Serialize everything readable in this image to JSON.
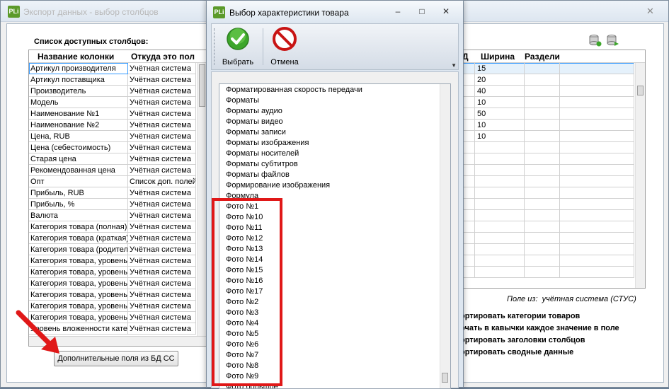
{
  "background_window": {
    "title": "Экспорт данных - выбор столбцов",
    "icon_text": "PLi",
    "close_glyph": "✕",
    "list_caption": "Список доступных столбцов:",
    "columns": [
      "Название колонки",
      "Откуда это пол"
    ],
    "rows": [
      {
        "name": "Артикул производителя",
        "source": "Учётная система"
      },
      {
        "name": "Артикул поставщика",
        "source": "Учётная система"
      },
      {
        "name": "Производитель",
        "source": "Учётная система"
      },
      {
        "name": "Модель",
        "source": "Учётная система"
      },
      {
        "name": "Наименование №1",
        "source": "Учётная система"
      },
      {
        "name": "Наименование №2",
        "source": "Учётная система"
      },
      {
        "name": "Цена, RUB",
        "source": "Учётная система"
      },
      {
        "name": "Цена (себестоимость)",
        "source": "Учётная система"
      },
      {
        "name": "Старая цена",
        "source": "Учётная система"
      },
      {
        "name": "Рекомендованная цена",
        "source": "Учётная система"
      },
      {
        "name": "Опт",
        "source": "Список доп. полей"
      },
      {
        "name": "Прибыль, RUB",
        "source": "Учётная система"
      },
      {
        "name": "Прибыль, %",
        "source": "Учётная система"
      },
      {
        "name": "Валюта",
        "source": "Учётная система"
      },
      {
        "name": "Категория товара (полная)",
        "source": "Учётная система"
      },
      {
        "name": "Категория товара (краткая)",
        "source": "Учётная система"
      },
      {
        "name": "Категория товара (родитель)",
        "source": "Учётная система"
      },
      {
        "name": "Категория товара, уровень",
        "source": "Учётная система"
      },
      {
        "name": "Категория товара, уровень",
        "source": "Учётная система"
      },
      {
        "name": "Категория товара, уровень",
        "source": "Учётная система"
      },
      {
        "name": "Категория товара, уровень",
        "source": "Учётная система"
      },
      {
        "name": "Категория товара, уровень",
        "source": "Учётная система"
      },
      {
        "name": "Категория товара, уровень",
        "source": "Учётная система"
      },
      {
        "name": "Уровень вложенности кате",
        "source": "Учётная система"
      }
    ],
    "extra_fields_button": "Дополнительные поля из БД СС",
    "right_grid": {
      "columns": [
        "Д",
        "Ширина",
        "Раздели"
      ],
      "widths": [
        "15",
        "20",
        "40",
        "10",
        "50",
        "10",
        "10"
      ]
    },
    "field_from_label": "Поле из:",
    "field_from_value": "учётная система (СТУС)",
    "options": [
      "ортировать категории товаров",
      "очать в кавычки каждое значение в поле",
      "ортировать заголовки столбцов",
      "ортировать сводные данные"
    ]
  },
  "dialog": {
    "title": "Выбор характеристики товара",
    "icon_text": "PLi",
    "minimize_glyph": "–",
    "maximize_glyph": "□",
    "close_glyph": "✕",
    "toolbar": {
      "select_label": "Выбрать",
      "cancel_label": "Отмена"
    },
    "items": [
      "Форматированная скорость передачи",
      "Форматы",
      "Форматы аудио",
      "Форматы видео",
      "Форматы записи",
      "Форматы изображения",
      "Форматы носителей",
      "Форматы субтитров",
      "Форматы файлов",
      "Формирование изображения",
      "Формула",
      "Фото №1",
      "Фото №10",
      "Фото №11",
      "Фото №12",
      "Фото №13",
      "Фото №14",
      "Фото №15",
      "Фото №16",
      "Фото №17",
      "Фото №2",
      "Фото №3",
      "Фото №4",
      "Фото №5",
      "Фото №6",
      "Фото №7",
      "Фото №8",
      "Фото №9",
      "Фото большое"
    ]
  },
  "colors": {
    "highlight_red": "#e01818",
    "accept_green": "#3da62b",
    "cancel_red": "#c81414"
  }
}
